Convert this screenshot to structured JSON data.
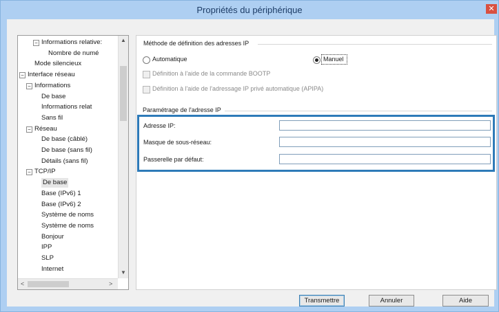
{
  "window": {
    "title": "Propriétés du périphérique",
    "close_glyph": "✕"
  },
  "tree": {
    "items": [
      {
        "label": "Informations relative:",
        "toggle": "−",
        "level": 2
      },
      {
        "label": "Nombre de numé",
        "toggle": null,
        "level": 3
      },
      {
        "label": "Mode silencieux",
        "toggle": null,
        "level": 1
      },
      {
        "label": "Interface réseau",
        "toggle": "−",
        "level": 0
      },
      {
        "label": "Informations",
        "toggle": "−",
        "level": 1
      },
      {
        "label": "De base",
        "toggle": null,
        "level": 2
      },
      {
        "label": "Informations relat",
        "toggle": null,
        "level": 2
      },
      {
        "label": "Sans fil",
        "toggle": null,
        "level": 2
      },
      {
        "label": "Réseau",
        "toggle": "−",
        "level": 1
      },
      {
        "label": "De base (câblé)",
        "toggle": null,
        "level": 2
      },
      {
        "label": "De base (sans fil)",
        "toggle": null,
        "level": 2
      },
      {
        "label": "Détails (sans fil)",
        "toggle": null,
        "level": 2
      },
      {
        "label": "TCP/IP",
        "toggle": "−",
        "level": 1
      },
      {
        "label": "De base",
        "toggle": null,
        "level": 2,
        "selected": true
      },
      {
        "label": "Base (IPv6) 1",
        "toggle": null,
        "level": 2
      },
      {
        "label": "Base (IPv6) 2",
        "toggle": null,
        "level": 2
      },
      {
        "label": "Système de noms",
        "toggle": null,
        "level": 2
      },
      {
        "label": "Système de noms",
        "toggle": null,
        "level": 2
      },
      {
        "label": "Bonjour",
        "toggle": null,
        "level": 2
      },
      {
        "label": "IPP",
        "toggle": null,
        "level": 2
      },
      {
        "label": "SLP",
        "toggle": null,
        "level": 2
      },
      {
        "label": "Internet",
        "toggle": null,
        "level": 2
      }
    ],
    "scroll_up": "▲",
    "scroll_down": "▼",
    "scroll_left": "<",
    "scroll_right": ">"
  },
  "method": {
    "group_title": "Méthode de définition des adresses IP",
    "automatic_label": "Automatique",
    "manual_label": "Manuel",
    "selected": "manual",
    "bootp_label": "Définition à l'aide de la commande BOOTP",
    "apipa_label": "Définition à l'aide de l'adressage IP privé automatique (APIPA)"
  },
  "ip_settings": {
    "group_title": "Paramétrage de l'adresse IP",
    "fields": [
      {
        "label": "Adresse IP:",
        "value": ""
      },
      {
        "label": "Masque de sous-réseau:",
        "value": ""
      },
      {
        "label": "Passerelle par défaut:",
        "value": ""
      }
    ]
  },
  "buttons": {
    "transmit": "Transmettre",
    "cancel": "Annuler",
    "help": "Aide"
  },
  "colors": {
    "title_bar": "#aecff2",
    "highlight_border": "#2d7ab8",
    "close_button": "#d95040"
  }
}
